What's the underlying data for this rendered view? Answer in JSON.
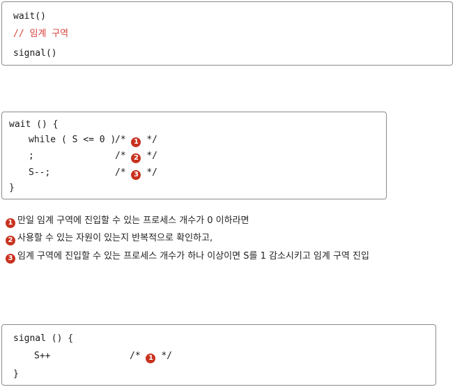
{
  "box1": {
    "line1": "wait()",
    "line2": "// 임계 구역",
    "line3": "signal()"
  },
  "box2": {
    "line1": "wait () {",
    "line2_code": "while ( S <= 0 )",
    "line3_code": ";",
    "line4_code": "S--;",
    "line5": "}",
    "comment_open": "/*",
    "comment_close": "*/",
    "markers": [
      "1",
      "2",
      "3"
    ]
  },
  "notes": [
    {
      "marker": "1",
      "text": "만일 임계 구역에 진입할 수 있는 프로세스 개수가 0 이하라면"
    },
    {
      "marker": "2",
      "text": "사용할 수 있는 자원이 있는지 반복적으로 확인하고,"
    },
    {
      "marker": "3",
      "text": "임계 구역에 진입할 수 있는 프로세스 개수가 하나 이상이면 S를 1 감소시키고 임계 구역 진입"
    }
  ],
  "box3": {
    "line1": "signal () {",
    "line2_code": "S++",
    "line3": "}",
    "comment_open": "/*",
    "comment_close": "*/",
    "marker": "1"
  },
  "colors": {
    "marker_bg": "#c8321f",
    "comment_red": "#d9403b",
    "border": "#8a8a8a"
  }
}
